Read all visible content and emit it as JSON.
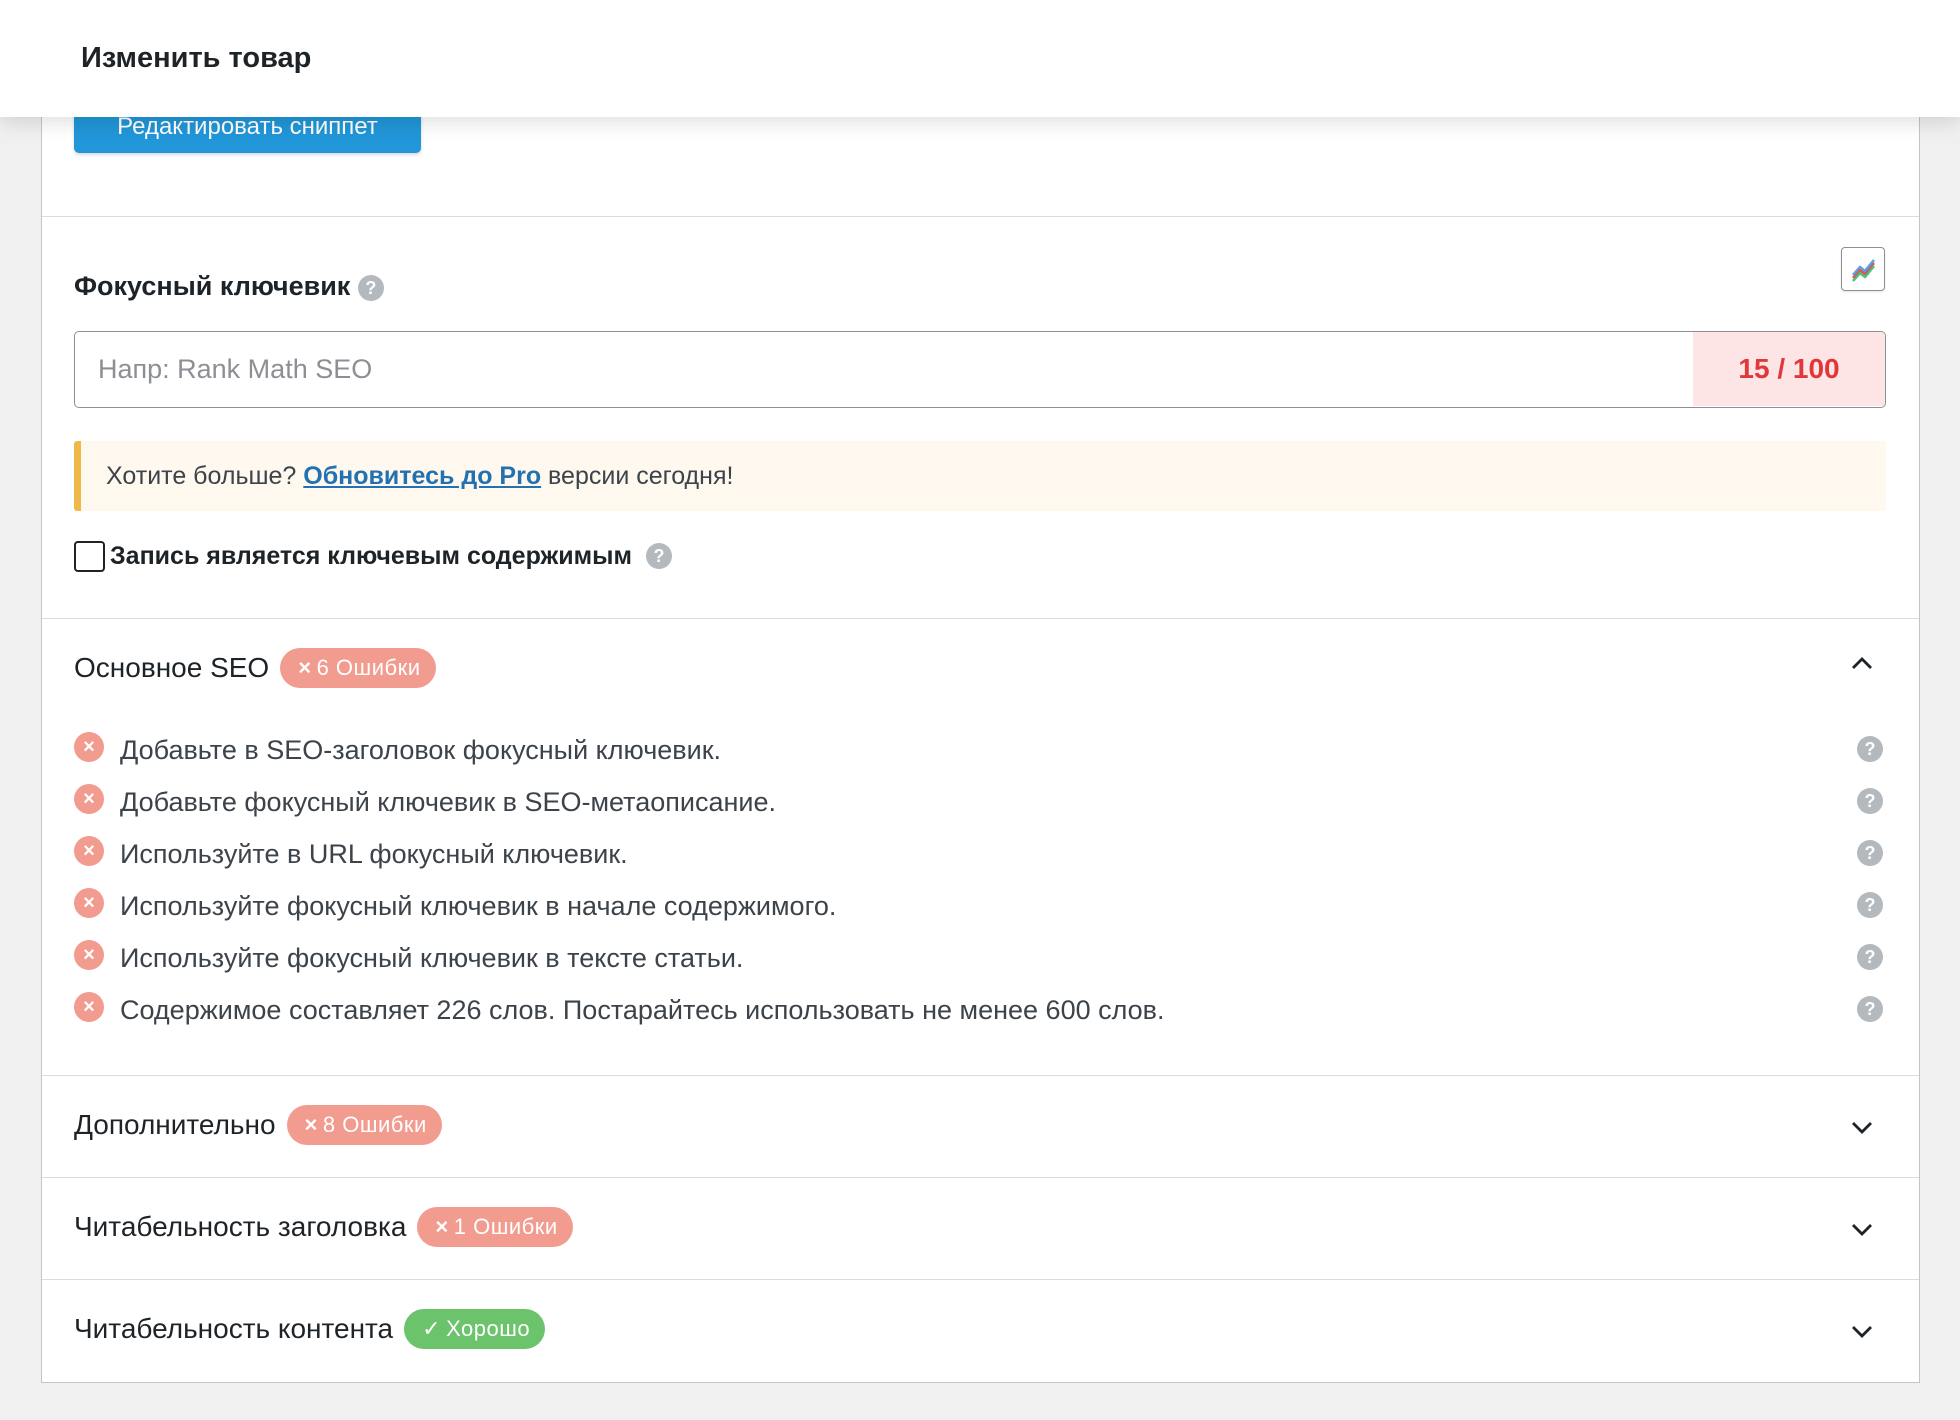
{
  "topbar": {
    "title": "Изменить товар"
  },
  "snippet": {
    "button_label": "Редактировать сниппет"
  },
  "focus_keyword": {
    "title": "Фокусный ключевик",
    "help": "?",
    "placeholder": "Напр: Rank Math SEO",
    "value": "",
    "score": "15 / 100",
    "trend_icon": "trend-chart-icon"
  },
  "pro_notice": {
    "prefix": "Хотите больше?",
    "link": "Обновитесь до Pro",
    "suffix": "версии сегодня!"
  },
  "pillar": {
    "label": "Запись является ключевым содержимым",
    "checked": false,
    "help": "?"
  },
  "sections": [
    {
      "title": "Основное SEO",
      "badge": "6 Ошибки",
      "badge_icon": "×",
      "status": "error",
      "expanded": true,
      "items": [
        "Добавьте в SEO-заголовок фокусный ключевик.",
        "Добавьте фокусный ключевик в SEO-метаописание.",
        "Используйте в URL фокусный ключевик.",
        "Используйте фокусный ключевик в начале содержимого.",
        "Используйте фокусный ключевик в тексте статьи.",
        "Содержимое составляет 226 слов. Постарайтесь использовать не менее 600 слов."
      ]
    },
    {
      "title": "Дополнительно",
      "badge": "8 Ошибки",
      "badge_icon": "×",
      "status": "error",
      "expanded": false
    },
    {
      "title": "Читабельность заголовка",
      "badge": "1 Ошибки",
      "badge_icon": "×",
      "status": "error",
      "expanded": false
    },
    {
      "title": "Читабельность контента",
      "badge": "Хорошо",
      "badge_icon": "✓",
      "status": "good",
      "expanded": false
    }
  ],
  "colors": {
    "accent_blue": "#2196d8",
    "error_badge": "#f29b8f",
    "good_badge": "#6bc36c",
    "score_red": "#e0373b",
    "notice_border": "#f0b849"
  },
  "icons": {
    "item_error": "×",
    "help": "?"
  }
}
